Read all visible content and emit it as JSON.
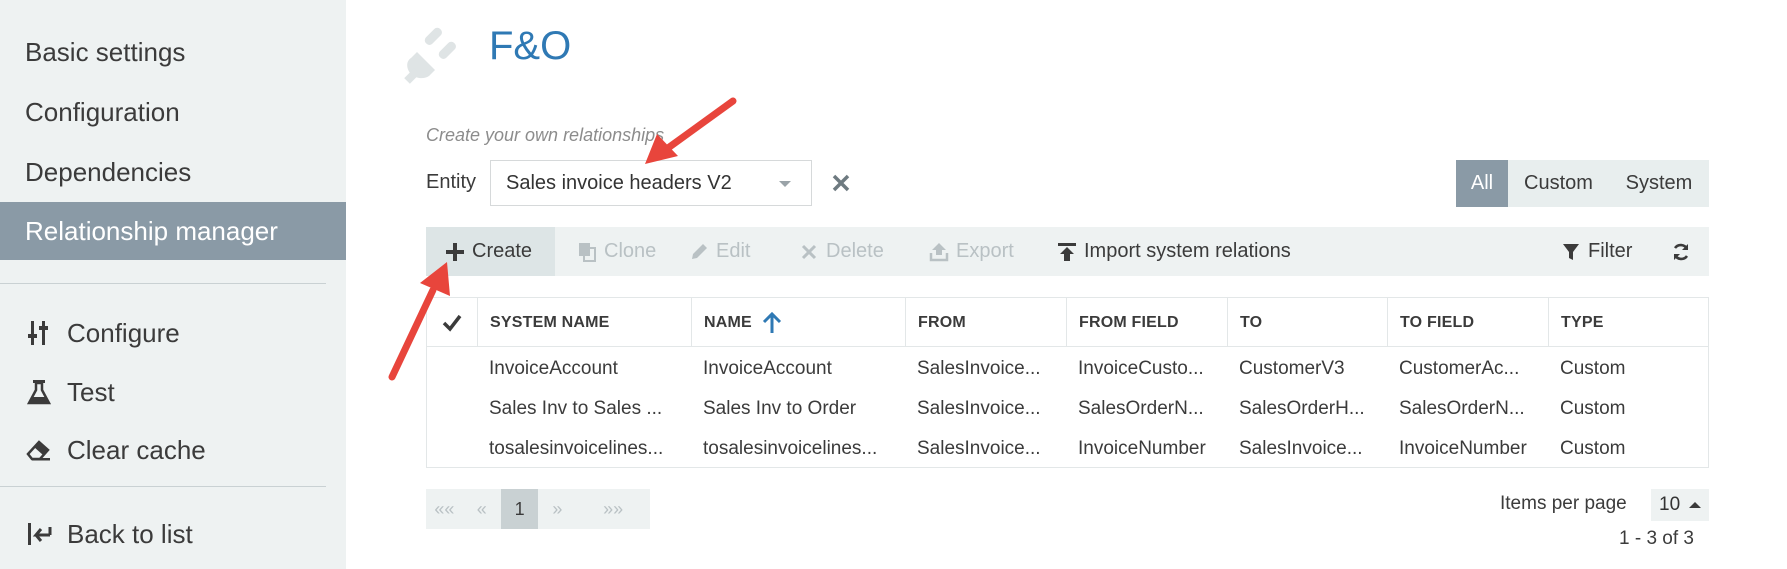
{
  "sidebar": {
    "items": [
      {
        "label": "Basic settings"
      },
      {
        "label": "Configuration"
      },
      {
        "label": "Dependencies"
      },
      {
        "label": "Relationship manager",
        "active": true
      }
    ],
    "actions": [
      {
        "label": "Configure",
        "icon": "sliders-icon"
      },
      {
        "label": "Test",
        "icon": "flask-icon"
      },
      {
        "label": "Clear cache",
        "icon": "eraser-icon"
      }
    ],
    "back": {
      "label": "Back to list",
      "icon": "back-arrow-icon"
    }
  },
  "header": {
    "title": "F&O",
    "icon": "plug-icon"
  },
  "filter": {
    "hint": "Create your own relationships",
    "entity_label": "Entity",
    "entity_value": "Sales invoice headers V2",
    "segments": [
      {
        "label": "All",
        "active": true
      },
      {
        "label": "Custom"
      },
      {
        "label": "System"
      }
    ]
  },
  "toolbar": {
    "create": "Create",
    "clone": "Clone",
    "edit": "Edit",
    "delete": "Delete",
    "export": "Export",
    "import": "Import system relations",
    "filter": "Filter"
  },
  "table": {
    "columns": [
      "SYSTEM NAME",
      "NAME",
      "FROM",
      "FROM FIELD",
      "TO",
      "TO FIELD",
      "TYPE"
    ],
    "sort_column": "NAME",
    "rows": [
      [
        "InvoiceAccount",
        "InvoiceAccount",
        "SalesInvoice...",
        "InvoiceCusto...",
        "CustomerV3",
        "CustomerAc...",
        "Custom"
      ],
      [
        "Sales Inv to Sales ...",
        "Sales Inv to Order",
        "SalesInvoice...",
        "SalesOrderN...",
        "SalesOrderH...",
        "SalesOrderN...",
        "Custom"
      ],
      [
        "tosalesinvoicelines...",
        "tosalesinvoicelines...",
        "SalesInvoice...",
        "InvoiceNumber",
        "SalesInvoice...",
        "InvoiceNumber",
        "Custom"
      ]
    ]
  },
  "pager": {
    "first": "««",
    "prev": "«",
    "current": "1",
    "next": "»",
    "last": "»»",
    "items_per_page_label": "Items per page",
    "items_per_page": "10",
    "range": "1 - 3 of 3"
  },
  "colors": {
    "accent": "#2f79b4",
    "sidebar_active": "#8a9aa6",
    "annotation_arrow": "#e8453c"
  }
}
